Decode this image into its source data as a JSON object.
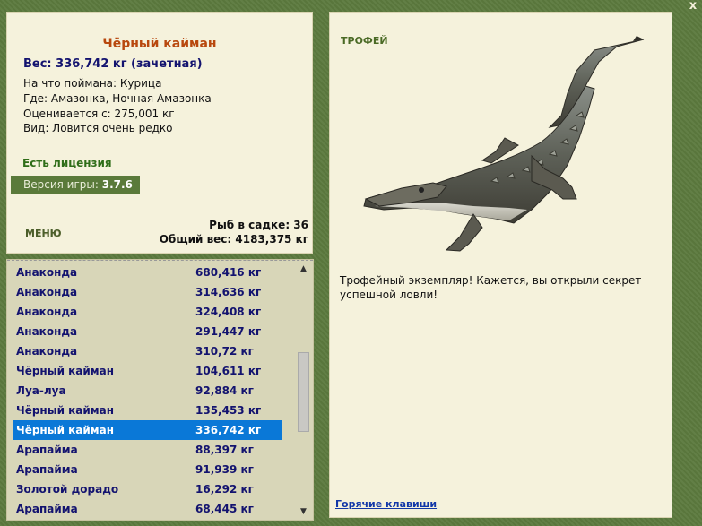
{
  "window": {
    "close_label": "x"
  },
  "catch": {
    "name": "Чёрный кайман",
    "weight_line": "Вес: 336,742 кг (зачетная)",
    "bait": "На что поймана: Курица",
    "location": "Где: Амазонка, Ночная Амазонка",
    "valued_from": "Оценивается с: 275,001 кг",
    "rarity": "Вид: Ловится очень редко"
  },
  "license": "Есть лицензия",
  "version": {
    "label": "Версия игры:",
    "value": "3.7.6"
  },
  "menu_label": "МЕНЮ",
  "stats": {
    "fish_count": "Рыб в садке: 36",
    "total_weight": "Общий вес: 4183,375 кг"
  },
  "list": [
    {
      "name": "Анаконда",
      "weight": "680,416 кг"
    },
    {
      "name": "Анаконда",
      "weight": "314,636 кг"
    },
    {
      "name": "Анаконда",
      "weight": "324,408 кг"
    },
    {
      "name": "Анаконда",
      "weight": "291,447 кг"
    },
    {
      "name": "Анаконда",
      "weight": "310,72 кг"
    },
    {
      "name": "Чёрный кайман",
      "weight": "104,611 кг"
    },
    {
      "name": "Луа-луа",
      "weight": "92,884 кг"
    },
    {
      "name": "Чёрный кайман",
      "weight": "135,453 кг"
    },
    {
      "name": "Чёрный кайман",
      "weight": "336,742 кг",
      "selected": true
    },
    {
      "name": "Арапайма",
      "weight": "88,397 кг"
    },
    {
      "name": "Арапайма",
      "weight": "91,939 кг"
    },
    {
      "name": "Золотой дорадо",
      "weight": "16,292 кг"
    },
    {
      "name": "Арапайма",
      "weight": "68,445 кг"
    }
  ],
  "trophy": {
    "label": "ТРОФЕЙ",
    "text": "Трофейный экземпляр! Кажется, вы открыли секрет успешной ловли!"
  },
  "hotkeys_label": "Горячие клавиши",
  "colors": {
    "selected_row": "#0a78d7",
    "name_color": "#b8480e",
    "list_text": "#13136f"
  },
  "icons": {
    "close": "close-icon",
    "scroll_up": "chevron-up-icon",
    "scroll_down": "chevron-down-icon"
  }
}
